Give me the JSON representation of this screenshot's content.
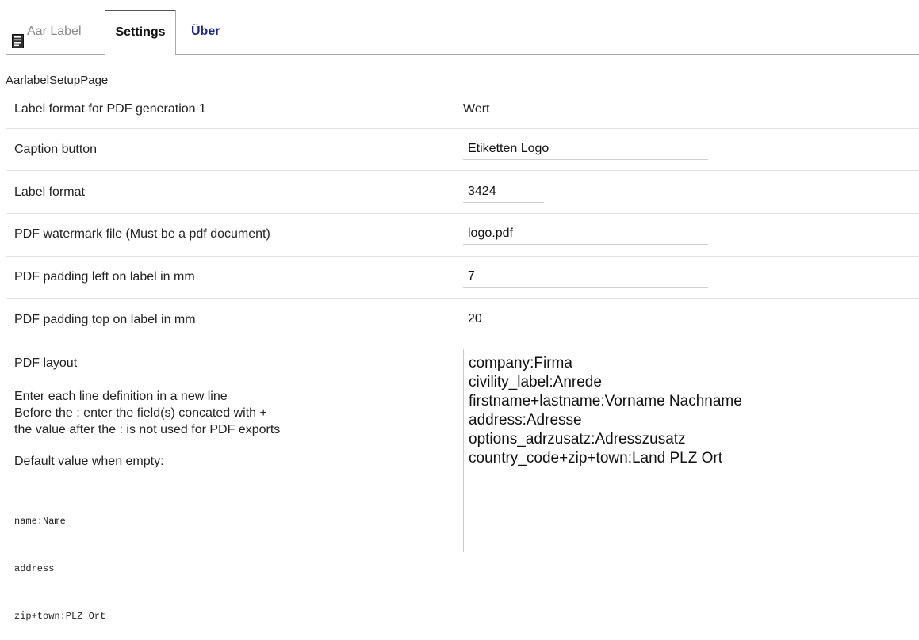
{
  "tabs": {
    "aar_label": "Aar Label",
    "settings": "Settings",
    "uber": "Über"
  },
  "section_title": "AarlabelSetupPage",
  "header": {
    "label": "Label format for PDF generation 1",
    "value": "Wert"
  },
  "fields": {
    "caption_button": {
      "label": "Caption button",
      "value": "Etiketten Logo"
    },
    "label_format": {
      "label": "Label format",
      "value": "3424"
    },
    "watermark": {
      "label": "PDF watermark file (Must be a pdf document)",
      "value": "logo.pdf"
    },
    "padding_left": {
      "label": "PDF padding left on label in mm",
      "value": "7"
    },
    "padding_top": {
      "label": "PDF padding top on label in mm",
      "value": "20"
    }
  },
  "pdf_layout": {
    "label": "PDF layout",
    "help_lines": [
      "Enter each line definition in a new line",
      "Before the : enter the field(s) concated with +",
      "the value after the : is not used for PDF exports"
    ],
    "default_label": "Default value when empty:",
    "default_lines": [
      "name:Name",
      "address",
      "zip+town:PLZ Ort"
    ],
    "value_lines": [
      "company:Firma",
      "civility_label:Anrede",
      "firstname+lastname:Vorname Nachname",
      "address:Adresse",
      "options_adrzusatz:Adresszusatz",
      "country_code+zip+town:Land PLZ Ort"
    ]
  }
}
